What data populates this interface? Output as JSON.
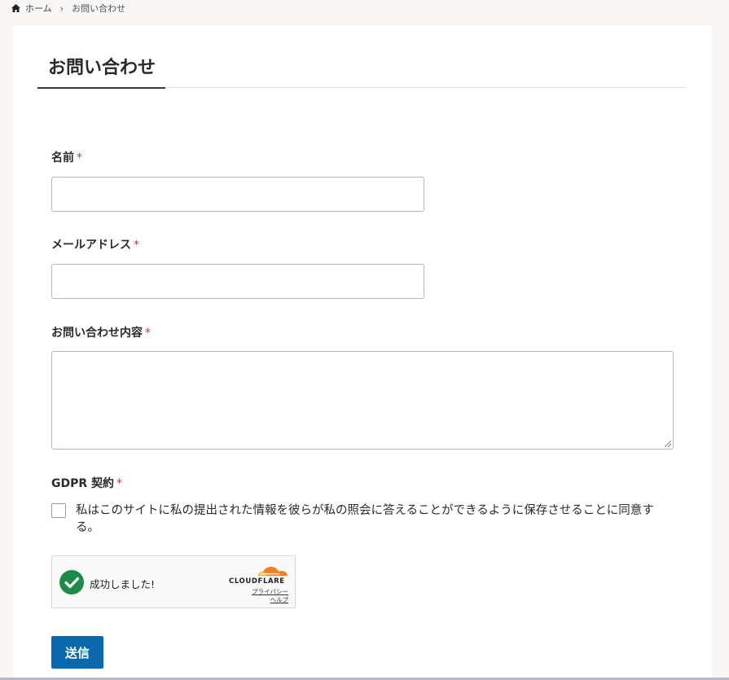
{
  "breadcrumb": {
    "home_label": "ホーム",
    "current_label": "お問い合わせ"
  },
  "page": {
    "title": "お問い合わせ"
  },
  "form": {
    "name": {
      "label": "名前",
      "required_mark": "*",
      "value": ""
    },
    "email": {
      "label": "メールアドレス",
      "required_mark": "*",
      "value": ""
    },
    "message": {
      "label": "お問い合わせ内容",
      "required_mark": "*",
      "value": ""
    },
    "gdpr": {
      "label": "GDPR 契約",
      "required_mark": "*",
      "checked": false,
      "consent_text": "私はこのサイトに私の提出された情報を彼らが私の照会に答えることができるように保存させることに同意する。"
    },
    "turnstile": {
      "status_text": "成功しました!",
      "brand": "CLOUDFLARE",
      "privacy_link": "プライバシー",
      "help_link": "ヘルプ"
    },
    "submit_label": "送信"
  },
  "colors": {
    "accent": "#0a69ad",
    "required": "#d0312d",
    "success": "#1e8a48",
    "cloudflare_orange": "#f38020"
  }
}
